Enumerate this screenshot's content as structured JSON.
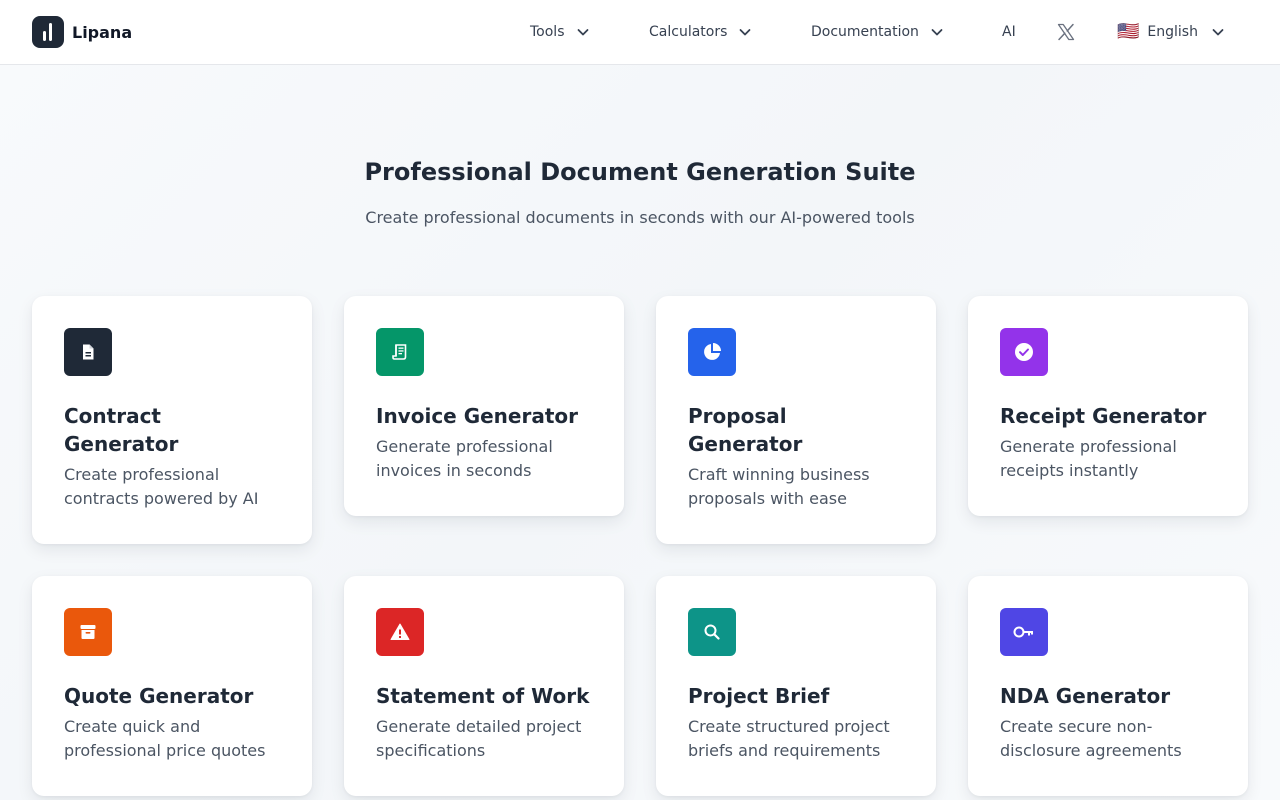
{
  "nav": {
    "brand": "Lipana",
    "tools": "Tools",
    "calculators": "Calculators",
    "documentation": "Documentation",
    "ai": "AI",
    "language": "English",
    "flag": "🇺🇸"
  },
  "hero": {
    "title": "Professional Document Generation Suite",
    "subtitle": "Create professional documents in seconds with our AI-powered tools"
  },
  "cards": [
    {
      "title": "Contract Generator",
      "desc": "Create professional contracts powered by AI",
      "color": "#1f2937",
      "icon": "document-icon"
    },
    {
      "title": "Invoice Generator",
      "desc": "Generate professional invoices in seconds",
      "color": "#059669",
      "icon": "receipt-scroll-icon"
    },
    {
      "title": "Proposal Generator",
      "desc": "Craft winning business proposals with ease",
      "color": "#2563eb",
      "icon": "pie-chart-icon"
    },
    {
      "title": "Receipt Generator",
      "desc": "Generate professional receipts instantly",
      "color": "#9333ea",
      "icon": "check-badge-icon"
    },
    {
      "title": "Quote Generator",
      "desc": "Create quick and professional price quotes",
      "color": "#ea580c",
      "icon": "archive-box-icon"
    },
    {
      "title": "Statement of Work",
      "desc": "Generate detailed project specifications",
      "color": "#dc2626",
      "icon": "warning-icon"
    },
    {
      "title": "Project Brief",
      "desc": "Create structured project briefs and requirements",
      "color": "#0d9488",
      "icon": "search-icon"
    },
    {
      "title": "NDA Generator",
      "desc": "Create secure non-disclosure agreements",
      "color": "#4f46e5",
      "icon": "key-icon"
    }
  ]
}
